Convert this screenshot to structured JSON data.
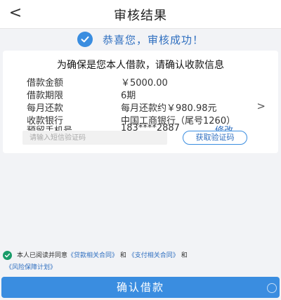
{
  "header": {
    "back_icon": "<",
    "title": "审核结果"
  },
  "success": {
    "icon": "check-circle-icon",
    "text": "恭喜您，审核成功！"
  },
  "card": {
    "title": "为确保是您本人借款，请确认收款信息",
    "rows": [
      {
        "label": "借款金额",
        "value": "￥5000.00"
      },
      {
        "label": "借款期限",
        "value": "6期"
      },
      {
        "label": "每月还款",
        "value": "每月还款约￥980.98元",
        "arrow": ">"
      },
      {
        "label": "收款银行",
        "value": "中国工商银行（尾号1260）"
      },
      {
        "label": "预留手机号",
        "value": "183****2887",
        "action": "修改"
      }
    ],
    "sms_input_placeholder": "请输入短信验证码",
    "get_code_label": "获取验证码"
  },
  "agreement": {
    "checked": true,
    "prefix": "本人已阅读并同意",
    "link1": "《贷款相关合同》",
    "and1": "和",
    "link2": "《支付相关合同》",
    "and2": "和",
    "link3": "《风险保障计划》"
  },
  "confirm_label": "确认借款",
  "colors": {
    "accent": "#3a8de0",
    "link": "#2f6fc0",
    "check_green": "#1a9c6a",
    "background": "#f2f3f6"
  }
}
